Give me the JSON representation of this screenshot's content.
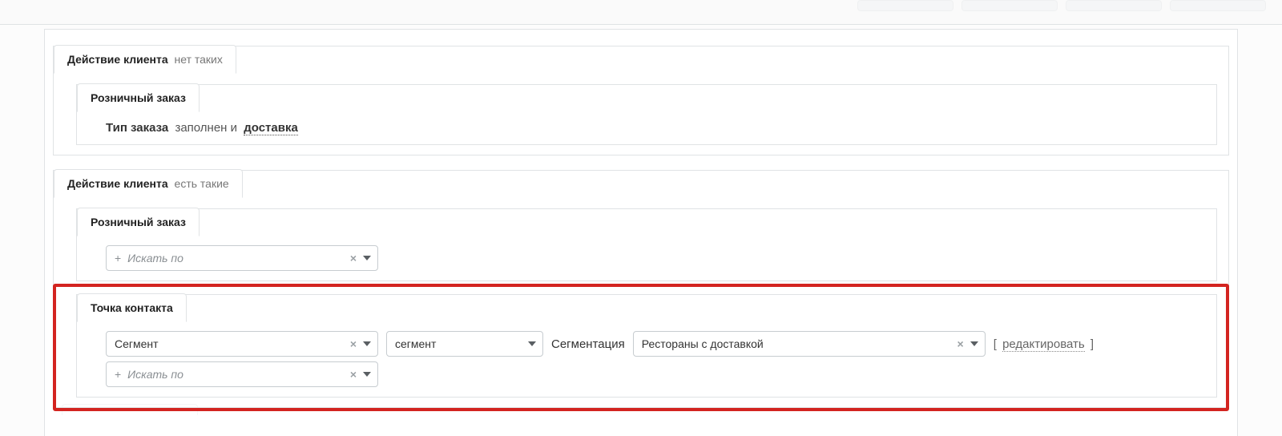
{
  "section1": {
    "title_strong": "Действие клиента",
    "title_suffix": "нет таких",
    "subgroup_label": "Розничный заказ",
    "rule": {
      "field": "Тип заказа",
      "op": "заполнен и",
      "value": "доставка"
    }
  },
  "section2": {
    "title_strong": "Действие клиента",
    "title_suffix": "есть такие",
    "subgroup_retail": {
      "label": "Розничный заказ",
      "search_placeholder": "Искать по",
      "search_prefix": "+"
    },
    "subgroup_contact": {
      "label": "Точка контакта",
      "field_select_value": "Сегмент",
      "operator_select_value": "сегмент",
      "segmentation_label": "Сегментация",
      "value_select_value": "Рестораны с доставкой",
      "edit_label": "редактировать",
      "search_placeholder": "Искать по",
      "search_prefix": "+"
    }
  }
}
